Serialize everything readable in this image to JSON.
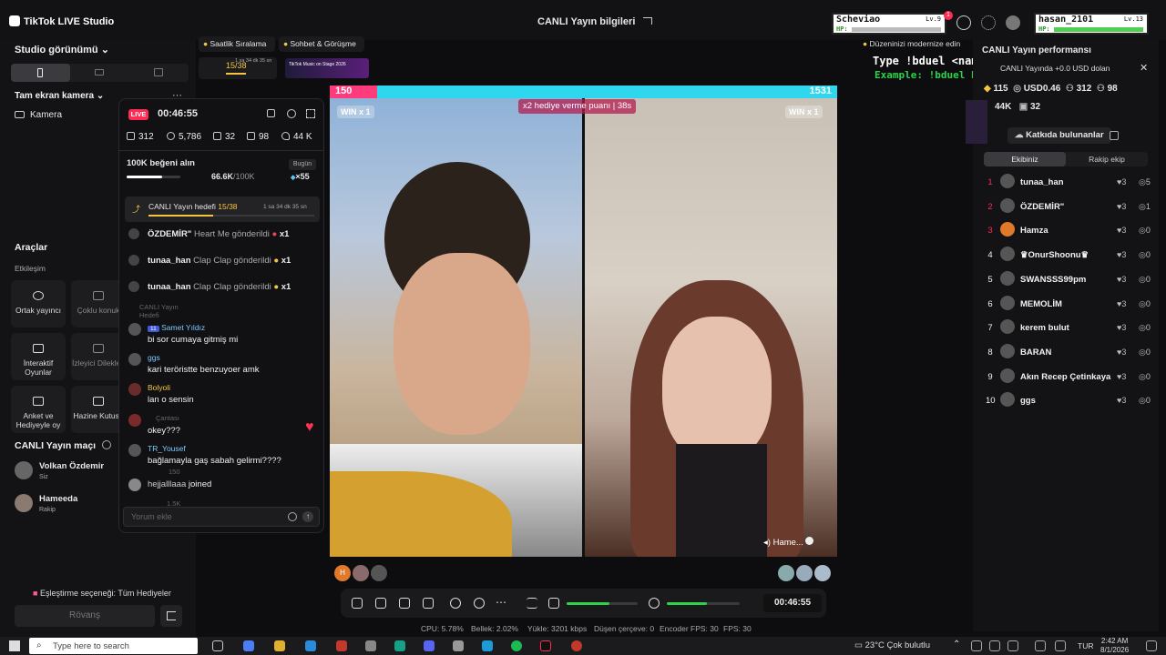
{
  "app": {
    "title": "TikTok LIVE Studio",
    "live_info": "CANLI Yayın bilgileri"
  },
  "players": {
    "left": {
      "name": "Scheviao",
      "level": "Lv.9",
      "hp_label": "HP:",
      "badge": "1"
    },
    "right": {
      "name": "hasan_2101",
      "level": "Lv.13",
      "hp_label": "HP:"
    }
  },
  "left_panel": {
    "studio_view": "Studio görünümü",
    "fullscreen_camera": "Tam ekran kamera",
    "camera": "Kamera",
    "tools": "Araçlar",
    "engagement": "Etkileşim",
    "tiles": [
      {
        "label": "Ortak yayıncı"
      },
      {
        "label": "Çoklu konuk"
      },
      {
        "label": "İnteraktif Oyunlar"
      },
      {
        "label": "İzleyici Dilekleri"
      },
      {
        "label": "Anket ve Hediyeyle oy"
      },
      {
        "label": "Hazine Kutusu"
      }
    ],
    "match_title": "CANLI Yayın maçı",
    "match_players": [
      {
        "name": "Volkan Özdemir",
        "role": "Siz"
      },
      {
        "name": "Hameeda",
        "role": "Rakip"
      }
    ],
    "matching_option": "Eşleştirme seçeneği: Tüm Hediyeler",
    "rematch": "Rövanş"
  },
  "top_tabs": [
    {
      "label": "Saatlik Sıralama"
    },
    {
      "label": "Sohbet & Görüşme"
    }
  ],
  "mini_goal": {
    "progress": "15/38",
    "time": "1 sa 34 dk 35 sn",
    "ad": "TikTok Music on Stage 2026"
  },
  "chat": {
    "live_badge": "LIVE",
    "timer": "00:46:55",
    "stats": {
      "viewers": "312",
      "views": "5,786",
      "gifts": "32",
      "members": "98",
      "likes": "44 K"
    },
    "likes_goal": {
      "title": "100K beğeni alın",
      "value": "66.6K",
      "target": "/100K",
      "today": "Bugün",
      "multiplier": "×55",
      "progress": 0.666
    },
    "live_goal": {
      "label": "CANLI Yayın hedefi",
      "progress": "15/38",
      "time": "1 sa 34 dk 35 sn",
      "fraction": 0.39
    },
    "gift_events": [
      {
        "user": "ÖZDEMİR\"",
        "action": "Heart Me gönderildi",
        "count": "x1"
      },
      {
        "user": "tunaa_han",
        "action": "Clap Clap gönderildi",
        "count": "x1"
      },
      {
        "user": "tunaa_han",
        "action": "Clap Clap gönderildi",
        "count": "x1"
      }
    ],
    "messages": [
      {
        "user": "Samet Yıldız",
        "level": "11",
        "text": "bi sor cumaya gitmiş mi"
      },
      {
        "user": "ggs",
        "text": "kari teröristte benzuyoer amk"
      },
      {
        "user": "Bolyoli",
        "text": "lan o sensin"
      },
      {
        "user": "",
        "text": "okey???"
      },
      {
        "user": "TR_Yousef",
        "text": "bağlamayla gaş sabah gelirmi????"
      },
      {
        "user": "hejjalllaaa",
        "text": "joined"
      }
    ],
    "ghost_labels": [
      "CANLI Yayın Hedefi",
      "Çantası",
      "150",
      "1.5K"
    ],
    "input_placeholder": "Yorum ekle"
  },
  "battle": {
    "left_score": "150",
    "right_score": "1531",
    "left_win": "WIN x 1",
    "right_win": "WIN x 1",
    "center_banner": "x2 hediye verme puanı | 38s",
    "right_name": "Hame...",
    "overlay_type": "Type !bduel <name> to play",
    "overlay_example": "Example: !bduel hasan_2101",
    "modernize": "Düzeninizi modernize edin"
  },
  "control_bar": {
    "timer": "00:46:55",
    "mic_level": 0.55,
    "speaker_level": 0.6
  },
  "status_bar": {
    "cpu": "CPU: 5.78%",
    "memory": "Bellek: 2.02%",
    "upload": "Yükle: 3201 kbps",
    "dropped": "Düşen çerçeve: 0",
    "encoder_fps": "Encoder FPS: 30",
    "fps": "FPS: 30"
  },
  "right_panel": {
    "title": "CANLI Yayın performansı",
    "notice": "CANLI Yayında +0.0 USD dolan",
    "stats": {
      "diamonds": "115",
      "usd": "USD0.46",
      "viewers": "312",
      "members": "98",
      "likes": "44K",
      "gifts": "32"
    },
    "contributors_btn": "Katkıda bulunanlar",
    "tabs": [
      {
        "label": "Ekibiniz"
      },
      {
        "label": "Rakip ekip"
      }
    ],
    "ranking": [
      {
        "rank": "1",
        "name": "tunaa_han",
        "score": "3",
        "coins": "5"
      },
      {
        "rank": "2",
        "name": "ÖZDEMİR\"",
        "score": "3",
        "coins": "1"
      },
      {
        "rank": "3",
        "name": "Hamza",
        "score": "3",
        "coins": "0"
      },
      {
        "rank": "4",
        "name": "♛OnurShoonu♛",
        "score": "3",
        "coins": "0"
      },
      {
        "rank": "5",
        "name": "SWANSSS99pm",
        "score": "3",
        "coins": "0"
      },
      {
        "rank": "6",
        "name": "MEMOLİM",
        "score": "3",
        "coins": "0"
      },
      {
        "rank": "7",
        "name": "kerem bulut",
        "score": "3",
        "coins": "0"
      },
      {
        "rank": "8",
        "name": "BARAN",
        "score": "3",
        "coins": "0"
      },
      {
        "rank": "9",
        "name": "Akın Recep Çetinkaya",
        "score": "3",
        "coins": "0"
      },
      {
        "rank": "10",
        "name": "ggs",
        "score": "3",
        "coins": "0"
      }
    ]
  },
  "taskbar": {
    "search_placeholder": "Type here to search",
    "weather": "23°C  Çok bulutlu",
    "lang": "TUR",
    "time": "2:42 AM",
    "date": "8/1/2026"
  },
  "colors": {
    "accent_pink": "#fe2c55",
    "score_cyan": "#2fd7ee",
    "score_pink": "#ff3b7b",
    "link_blue": "#7ec8ff"
  }
}
